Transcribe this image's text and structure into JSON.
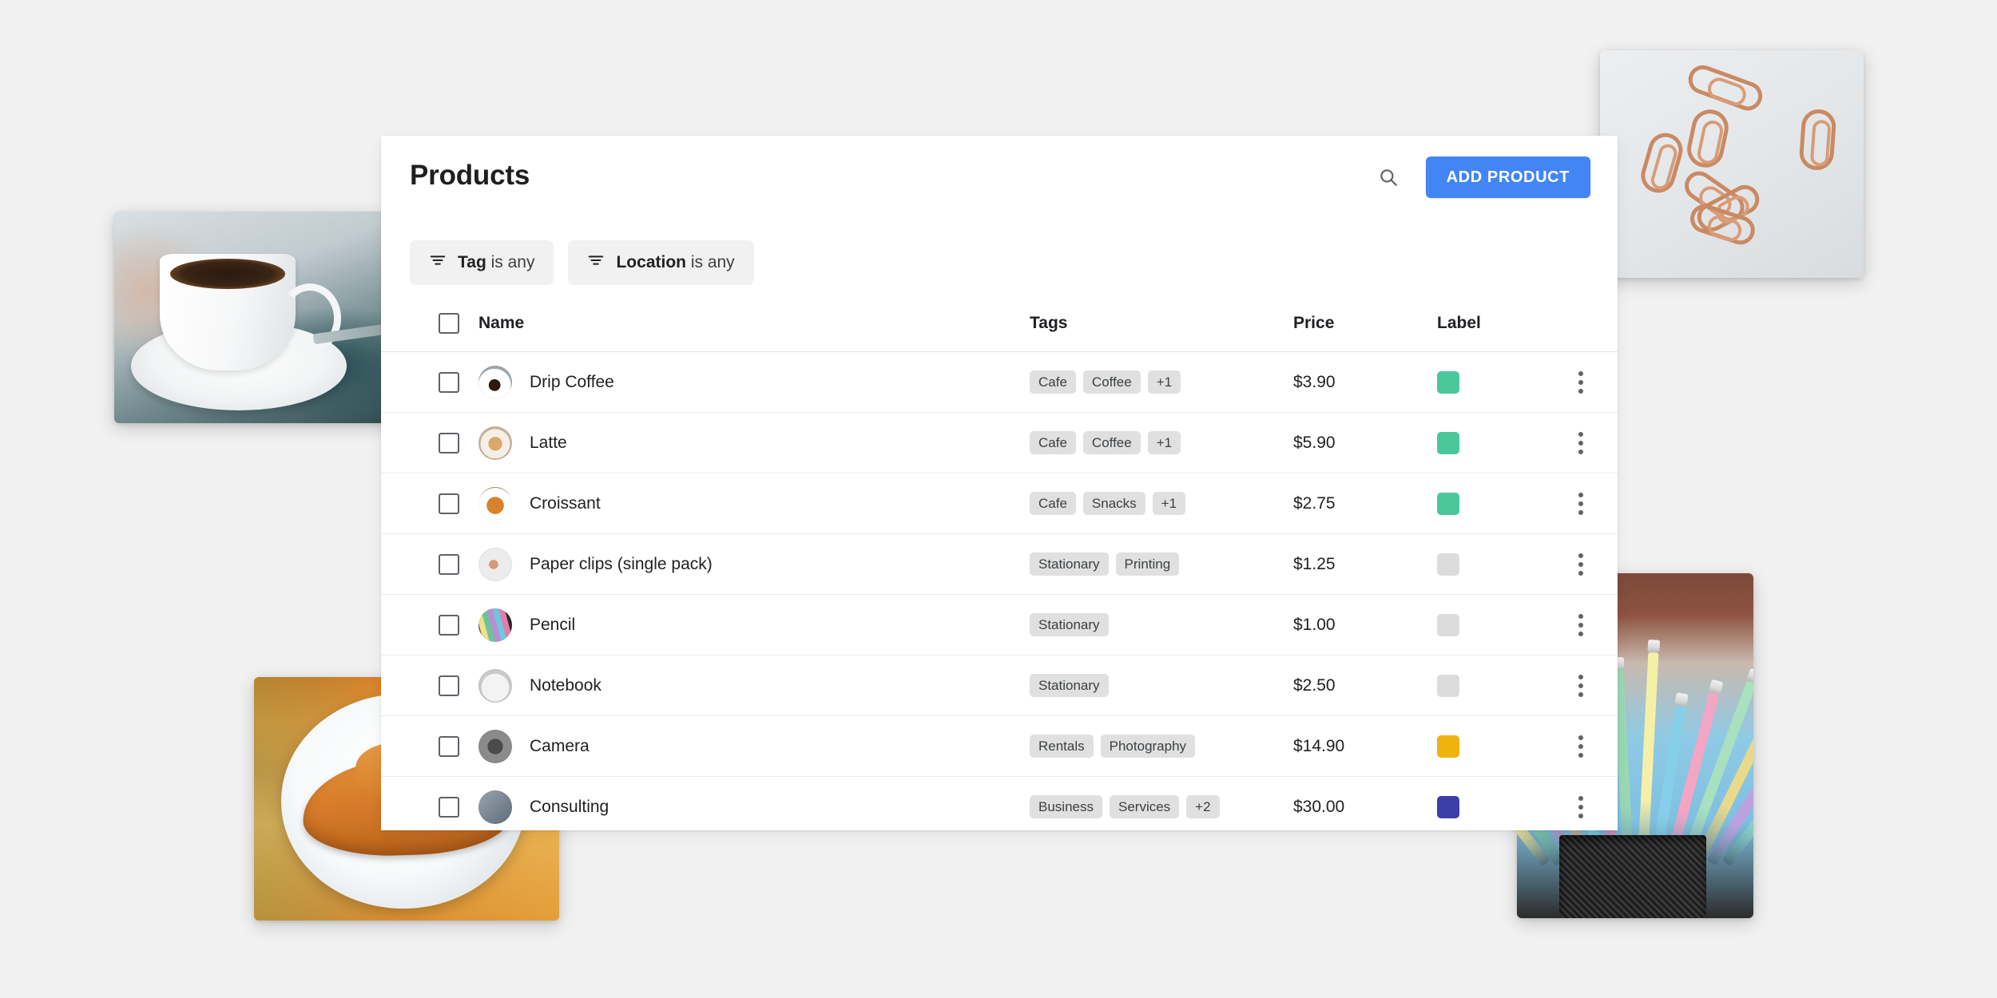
{
  "header": {
    "title": "Products",
    "search_icon": "search-icon",
    "add_product_label": "ADD PRODUCT"
  },
  "filters": [
    {
      "icon": "filter-icon",
      "field": "Tag",
      "operator": "is any"
    },
    {
      "icon": "filter-icon",
      "field": "Location",
      "operator": "is any"
    }
  ],
  "table": {
    "columns": [
      "",
      "Name",
      "Tags",
      "Price",
      "Label",
      ""
    ],
    "rows": [
      {
        "name": "Drip Coffee",
        "tags": [
          "Cafe",
          "Coffee"
        ],
        "overflow": "+1",
        "price": "$3.90",
        "label_color": "#4AC79B",
        "avatar": "coffee"
      },
      {
        "name": "Latte",
        "tags": [
          "Cafe",
          "Coffee"
        ],
        "overflow": "+1",
        "price": "$5.90",
        "label_color": "#4AC79B",
        "avatar": "latte"
      },
      {
        "name": "Croissant",
        "tags": [
          "Cafe",
          "Snacks"
        ],
        "overflow": "+1",
        "price": "$2.75",
        "label_color": "#4AC79B",
        "avatar": "croissant"
      },
      {
        "name": "Paper clips (single pack)",
        "tags": [
          "Stationary",
          "Printing"
        ],
        "overflow": "",
        "price": "$1.25",
        "label_color": "#DCDCDC",
        "avatar": "clips"
      },
      {
        "name": "Pencil",
        "tags": [
          "Stationary"
        ],
        "overflow": "",
        "price": "$1.00",
        "label_color": "#DCDCDC",
        "avatar": "pencil"
      },
      {
        "name": "Notebook",
        "tags": [
          "Stationary"
        ],
        "overflow": "",
        "price": "$2.50",
        "label_color": "#DCDCDC",
        "avatar": "notebook"
      },
      {
        "name": "Camera",
        "tags": [
          "Rentals",
          "Photography"
        ],
        "overflow": "",
        "price": "$14.90",
        "label_color": "#EFB310",
        "avatar": "camera"
      },
      {
        "name": "Consulting",
        "tags": [
          "Business",
          "Services"
        ],
        "overflow": "+2",
        "price": "$30.00",
        "label_color": "#3E3EA8",
        "avatar": "consulting"
      }
    ]
  },
  "photos": [
    {
      "name": "coffee-cup-photo",
      "alt": "White cup of black coffee on a saucer"
    },
    {
      "name": "paper-clips-photo",
      "alt": "Copper paper clips scattered on a grey surface"
    },
    {
      "name": "croissant-photo",
      "alt": "Croissant on a white plate on a wooden table"
    },
    {
      "name": "pencils-photo",
      "alt": "Pastel coloured pencils in a black mesh cup"
    }
  ],
  "colors": {
    "accent": "#4285F4",
    "background": "#F1F1F1",
    "card": "#FFFFFF",
    "chip": "#F1F1F1",
    "tag": "#E0E0E0"
  }
}
